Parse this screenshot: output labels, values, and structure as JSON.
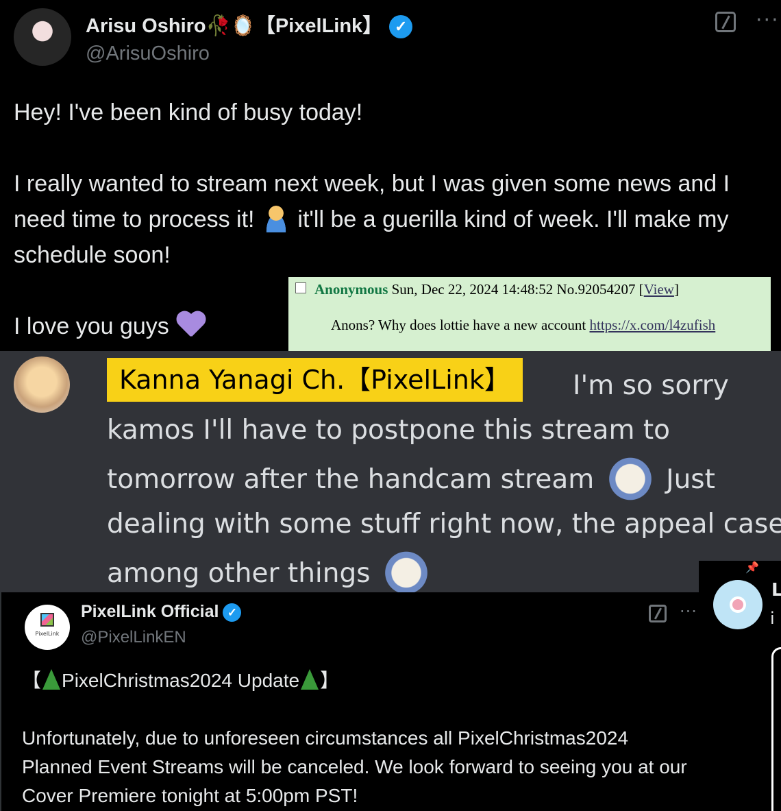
{
  "tweet1": {
    "display_name": "Arisu Oshiro🥀🪞【PixelLink】",
    "handle": "@ArisuOshiro",
    "line1": "Hey! I've been kind of busy today!",
    "line2a": "I really wanted to stream next week, but I was given some news and I need time to process it!",
    "line2b": "it'll be a guerilla kind of week. I'll make my schedule soon!",
    "line3": "I love you guys"
  },
  "post": {
    "name": "Anonymous",
    "datetime": "Sun, Dec 22, 2024 14:48:52",
    "number": "No.92054207",
    "view_open": "[",
    "view_label": "View",
    "view_close": "]",
    "text": "Anons? Why does lottie have a new account",
    "url": "https://x.com/l4zufish"
  },
  "discord": {
    "name_tag": "Kanna Yanagi Ch.【PixelLink】",
    "text_a": "I'm so sorry kamos I'll have to postpone this stream to tomorrow after the handcam stream",
    "text_b": "Just dealing with some stuff right now, the appeal case among other things"
  },
  "side": {
    "pin_initial": "P",
    "name_initial": "L",
    "text_initial": "i"
  },
  "tweet2": {
    "display_name": "PixelLink Official",
    "handle": "@PixelLinkEN",
    "avatar_label": "PixelLink",
    "headline_open": "【",
    "headline": "PixelChristmas2024 Update",
    "headline_close": "】",
    "body": "Unfortunately, due to unforeseen circumstances all PixelChristmas2024 Planned Event Streams will be canceled.  We look forward to seeing you at our Cover Premiere tonight at 5:00pm PST!"
  },
  "icons": {
    "verified": "verified-badge-icon",
    "edit": "grok-icon",
    "more": "more-icon",
    "pin": "pin-icon"
  },
  "colors": {
    "background": "#000000",
    "verified_blue": "#1d9bf0",
    "muted_text": "#71767b",
    "discord_bg": "#313338",
    "name_highlight": "#f8d117",
    "post_bg": "#d6f0d0",
    "anon_name": "#117743"
  }
}
